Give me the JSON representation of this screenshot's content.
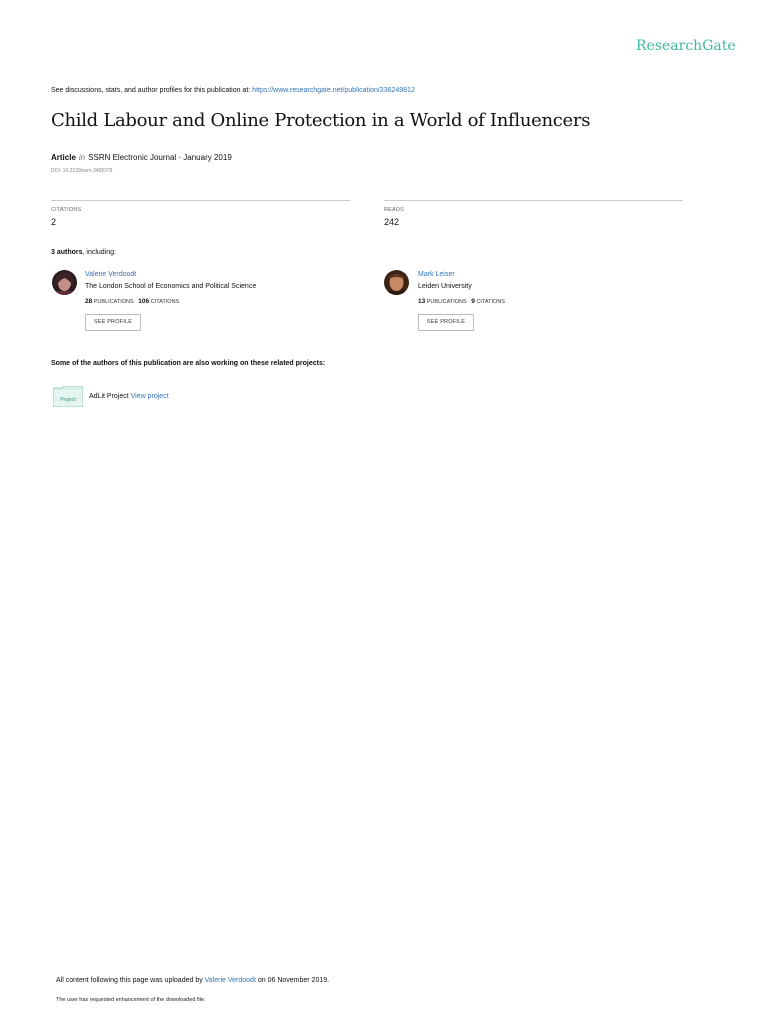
{
  "brand": "ResearchGate",
  "discussion": {
    "prefix": "See discussions, stats, and author profiles for this publication at: ",
    "link": "https://www.researchgate.net/publication/336249812"
  },
  "title": "Child Labour and Online Protection in a World of Influencers",
  "meta": {
    "type": "Article",
    "in": "in",
    "journal": "SSRN Electronic Journal · January 2019",
    "doi": "DOI: 10.2139/ssrn.3458379"
  },
  "stats": {
    "citations_label": "CITATIONS",
    "citations_value": "2",
    "reads_label": "READS",
    "reads_value": "242"
  },
  "authors_heading": {
    "count": "3 authors",
    "suffix": ", including:"
  },
  "authors": [
    {
      "name": "Valerie Verdoodt",
      "institution": "The London School of Economics and Political Science",
      "publications": "28",
      "publications_label": "PUBLICATIONS",
      "citations": "106",
      "citations_label": "CITATIONS",
      "button": "SEE PROFILE"
    },
    {
      "name": "Mark Leiser",
      "institution": "Leiden University",
      "publications": "13",
      "publications_label": "PUBLICATIONS",
      "citations": "9",
      "citations_label": "CITATIONS",
      "button": "SEE PROFILE"
    }
  ],
  "related": {
    "heading": "Some of the authors of this publication are also working on these related projects:",
    "icon_label": "Project",
    "project_name": "AdLit Project",
    "project_link": "View project"
  },
  "footer": {
    "uploaded_prefix": "All content following this page was uploaded by ",
    "uploaded_by": "Valerie Verdoodt",
    "uploaded_suffix": " on 06 November 2019.",
    "enhancement": "The user has requested enhancement of the downloaded file."
  },
  "colors": {
    "brand": "#40ba9b",
    "link": "#3275b6"
  }
}
